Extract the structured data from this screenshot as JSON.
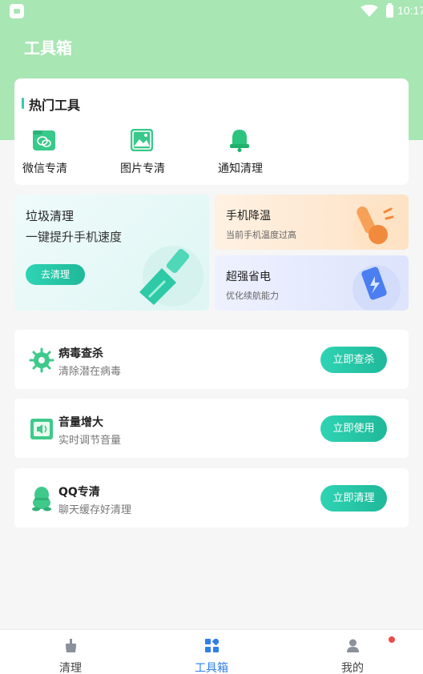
{
  "status_bar": {
    "time": "10:17",
    "app_icon": "store-icon",
    "wifi_icon": "wifi-icon",
    "battery_icon": "battery-icon"
  },
  "header": {
    "title": "工具箱",
    "background": "#a8e6b3"
  },
  "hot_tools": {
    "title": "热门工具",
    "items": [
      {
        "label": "微信专清",
        "icon": "wechat-folder-icon"
      },
      {
        "label": "图片专清",
        "icon": "image-icon"
      },
      {
        "label": "通知清理",
        "icon": "bell-icon"
      }
    ]
  },
  "feature_cards": {
    "clean": {
      "title": "垃圾清理",
      "subtitle": "一键提升手机速度",
      "button": "去清理",
      "icon": "brush-icon"
    },
    "cool": {
      "title": "手机降温",
      "subtitle": "当前手机温度过高",
      "icon": "thermometer-icon"
    },
    "power": {
      "title": "超强省电",
      "subtitle": "优化续航能力",
      "icon": "battery-bolt-icon"
    }
  },
  "tool_list": [
    {
      "name": "病毒查杀",
      "desc": "清除潜在病毒",
      "action": "立即查杀",
      "icon": "virus-icon"
    },
    {
      "name": "音量增大",
      "desc": "实时调节音量",
      "action": "立即使用",
      "icon": "speaker-icon"
    },
    {
      "name": "QQ专清",
      "desc": "聊天缓存好清理",
      "action": "立即清理",
      "icon": "qq-penguin-icon"
    }
  ],
  "tabbar": {
    "items": [
      {
        "label": "清理",
        "icon": "broom-icon",
        "active": false
      },
      {
        "label": "工具箱",
        "icon": "grid-icon",
        "active": true
      },
      {
        "label": "我的",
        "icon": "person-icon",
        "active": false,
        "badge": true
      }
    ]
  },
  "colors": {
    "accent": "#20c5a3",
    "active_tab": "#2f7fe8",
    "badge": "#f04848"
  }
}
